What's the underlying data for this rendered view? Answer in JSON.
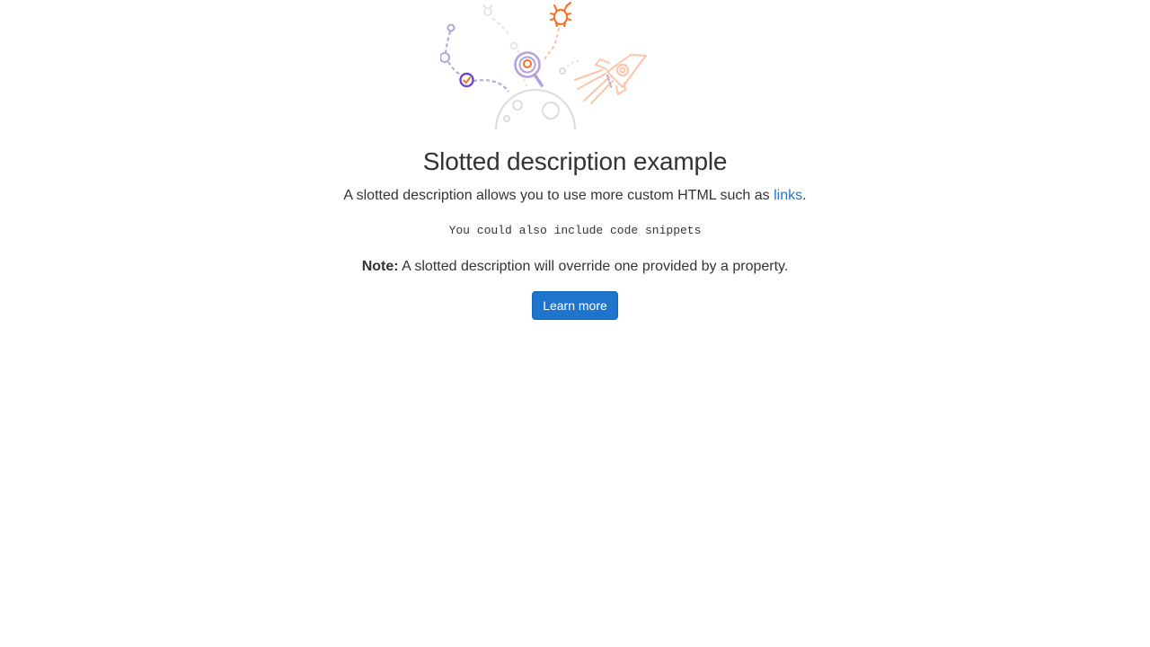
{
  "empty_state": {
    "title": "Slotted description example",
    "description": {
      "line1_prefix": "A slotted description allows you to use more custom HTML such as ",
      "link_text": "links",
      "line1_suffix": ".",
      "code_snippet": "You could also include code snippets",
      "note_label": "Note:",
      "note_text": " A slotted description will override one provided by a property."
    },
    "primary_button_label": "Learn more"
  },
  "colors": {
    "primary": "#1f75cb",
    "text": "#333238",
    "illustration_purple": "#6e49cb",
    "illustration_light_purple": "#b2a3e0",
    "illustration_orange": "#fc6d26",
    "illustration_light_orange": "#fdc4a8",
    "illustration_gray": "#dcdcde"
  }
}
